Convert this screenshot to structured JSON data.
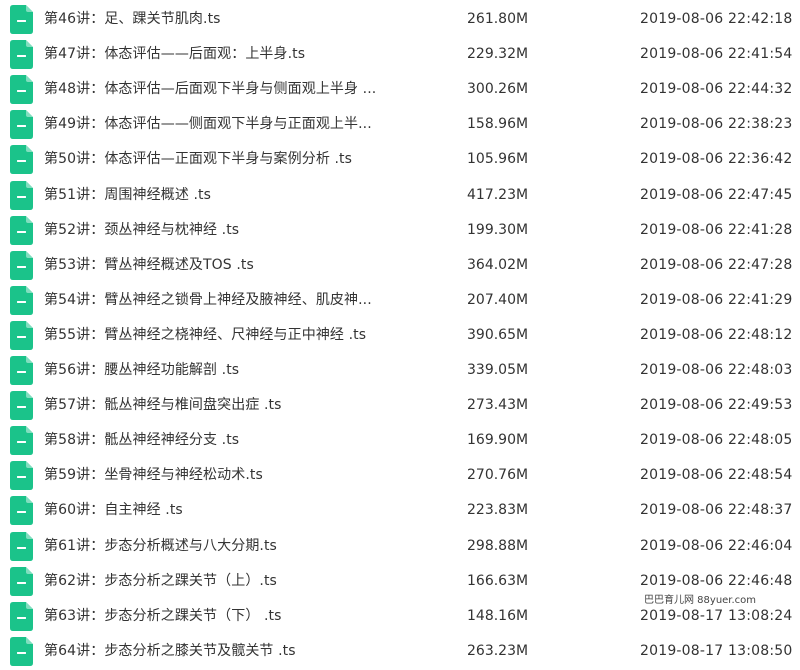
{
  "colors": {
    "icon_fill": "#1bc38a",
    "icon_mark": "#ffffff",
    "text": "#333333"
  },
  "watermark": "巴巴育儿网 88yuer.com",
  "files": [
    {
      "icon": "document-icon",
      "name": "第46讲：足、踝关节肌肉.ts",
      "size": "261.80M",
      "date": "2019-08-06 22:42:18"
    },
    {
      "icon": "document-icon",
      "name": "第47讲：体态评估——后面观：上半身.ts",
      "size": "229.32M",
      "date": "2019-08-06 22:41:54"
    },
    {
      "icon": "document-icon",
      "name": "第48讲：体态评估—后面观下半身与侧面观上半身 ...",
      "size": "300.26M",
      "date": "2019-08-06 22:44:32"
    },
    {
      "icon": "document-icon",
      "name": "第49讲：体态评估——侧面观下半身与正面观上半...",
      "size": "158.96M",
      "date": "2019-08-06 22:38:23"
    },
    {
      "icon": "document-icon",
      "name": "第50讲：体态评估—正面观下半身与案例分析 .ts",
      "size": "105.96M",
      "date": "2019-08-06 22:36:42"
    },
    {
      "icon": "document-icon",
      "name": "第51讲：周围神经概述 .ts",
      "size": "417.23M",
      "date": "2019-08-06 22:47:45"
    },
    {
      "icon": "document-icon",
      "name": "第52讲：颈丛神经与枕神经 .ts",
      "size": "199.30M",
      "date": "2019-08-06 22:41:28"
    },
    {
      "icon": "document-icon",
      "name": "第53讲：臂丛神经概述及TOS .ts",
      "size": "364.02M",
      "date": "2019-08-06 22:47:28"
    },
    {
      "icon": "document-icon",
      "name": "第54讲：臂丛神经之锁骨上神经及腋神经、肌皮神...",
      "size": "207.40M",
      "date": "2019-08-06 22:41:29"
    },
    {
      "icon": "document-icon",
      "name": "第55讲：臂丛神经之桡神经、尺神经与正中神经 .ts",
      "size": "390.65M",
      "date": "2019-08-06 22:48:12"
    },
    {
      "icon": "document-icon",
      "name": "第56讲：腰丛神经功能解剖 .ts",
      "size": "339.05M",
      "date": "2019-08-06 22:48:03"
    },
    {
      "icon": "document-icon",
      "name": "第57讲：骶丛神经与椎间盘突出症 .ts",
      "size": "273.43M",
      "date": "2019-08-06 22:49:53"
    },
    {
      "icon": "document-icon",
      "name": "第58讲：骶丛神经神经分支 .ts",
      "size": "169.90M",
      "date": "2019-08-06 22:48:05"
    },
    {
      "icon": "document-icon",
      "name": "第59讲：坐骨神经与神经松动术.ts",
      "size": "270.76M",
      "date": "2019-08-06 22:48:54"
    },
    {
      "icon": "document-icon",
      "name": "第60讲：自主神经 .ts",
      "size": "223.83M",
      "date": "2019-08-06 22:48:37"
    },
    {
      "icon": "document-icon",
      "name": "第61讲：步态分析概述与八大分期.ts",
      "size": "298.88M",
      "date": "2019-08-06 22:46:04"
    },
    {
      "icon": "document-icon",
      "name": "第62讲：步态分析之踝关节（上）.ts",
      "size": "166.63M",
      "date": "2019-08-06 22:46:48"
    },
    {
      "icon": "document-icon",
      "name": "第63讲：步态分析之踝关节（下） .ts",
      "size": "148.16M",
      "date": "2019-08-17 13:08:24"
    },
    {
      "icon": "document-icon",
      "name": "第64讲：步态分析之膝关节及髋关节 .ts",
      "size": "263.23M",
      "date": "2019-08-17 13:08:50"
    }
  ]
}
